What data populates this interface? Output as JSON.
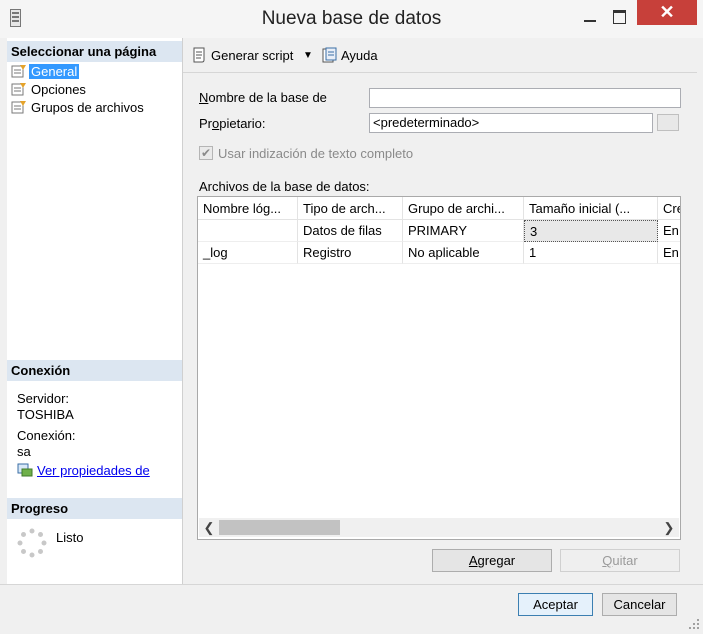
{
  "window": {
    "title": "Nueva base de datos",
    "close_glyph": "✕"
  },
  "left_pane": {
    "select_page_header": "Seleccionar una página",
    "nav_items": [
      {
        "label": "General",
        "selected": true,
        "icon": "settings-page-icon"
      },
      {
        "label": "Opciones",
        "selected": false,
        "icon": "settings-page-icon"
      },
      {
        "label": "Grupos de archivos",
        "selected": false,
        "icon": "settings-page-icon"
      }
    ],
    "connection_header": "Conexión",
    "server_label": "Servidor:",
    "server_value": "TOSHIBA",
    "connection_label": "Conexión:",
    "connection_value": "sa",
    "view_properties_link": "Ver propiedades de",
    "progress_header": "Progreso",
    "progress_status": "Listo"
  },
  "toolbar": {
    "generate_script": "Generar script",
    "help": "Ayuda"
  },
  "form": {
    "db_name_label_acc": "N",
    "db_name_label_rest": "ombre de la base de",
    "db_name_value": "",
    "owner_label_pre": "Pr",
    "owner_label_acc": "o",
    "owner_label_rest": "pietario:",
    "owner_value": "<predeterminado>",
    "fulltext_label": "Usar indización de texto completo",
    "fulltext_checked": true,
    "files_label": "Archivos de la base de datos:"
  },
  "grid": {
    "columns": [
      "Nombre lóg...",
      "Tipo de arch...",
      "Grupo de archi...",
      "Tamaño inicial (...",
      "Cre"
    ],
    "rows": [
      [
        "",
        "Datos de filas",
        "PRIMARY",
        "3",
        "En"
      ],
      [
        "_log",
        "Registro",
        "No aplicable",
        "1",
        "En"
      ]
    ]
  },
  "buttons": {
    "add_acc": "A",
    "add_rest": "gregar",
    "remove_acc": "Q",
    "remove_rest": "uitar",
    "ok": "Aceptar",
    "cancel": "Cancelar"
  }
}
